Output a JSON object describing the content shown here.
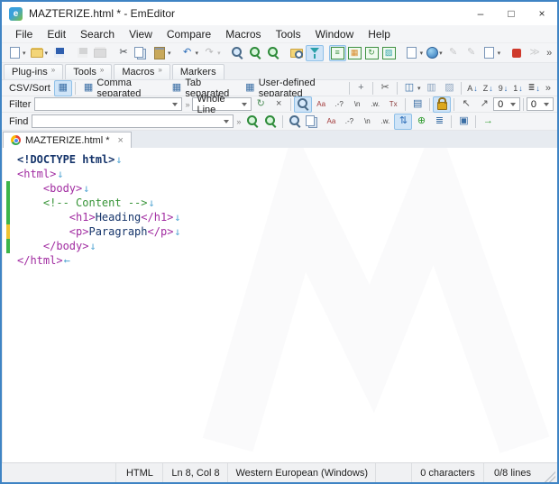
{
  "window": {
    "title": "MAZTERIZE.html * - EmEditor",
    "controls": {
      "minimize": "–",
      "maximize": "□",
      "close": "×"
    }
  },
  "menu": {
    "items": [
      "File",
      "Edit",
      "Search",
      "View",
      "Compare",
      "Macros",
      "Tools",
      "Window",
      "Help"
    ]
  },
  "toolbar_main": {
    "overflow": "»",
    "items": [
      {
        "name": "new-file",
        "shape": "page",
        "dropdown": true
      },
      {
        "name": "open-file",
        "shape": "folder",
        "dropdown": true
      },
      {
        "name": "save",
        "shape": "floppy"
      },
      {
        "sep": true
      },
      {
        "name": "save-all",
        "shape": "floppy-gray",
        "disabled": true
      },
      {
        "name": "print",
        "shape": "printer",
        "disabled": true
      },
      {
        "sep": true
      },
      {
        "name": "cut",
        "glyph": "✂",
        "color": "#3a3f44"
      },
      {
        "name": "copy",
        "shape": "copy"
      },
      {
        "name": "paste",
        "shape": "paste",
        "dropdown": true
      },
      {
        "sep": true
      },
      {
        "name": "undo",
        "glyph": "↶",
        "color": "#2b6cb8",
        "dropdown": true
      },
      {
        "name": "redo",
        "glyph": "↷",
        "color": "#555555",
        "disabled": true,
        "dropdown": true
      },
      {
        "sep": true
      },
      {
        "name": "find",
        "shape": "mag"
      },
      {
        "name": "find-next",
        "shape": "mag-green"
      },
      {
        "name": "replace",
        "shape": "mag-green"
      },
      {
        "sep": true
      },
      {
        "name": "find-in-files",
        "shape": "folder-mag"
      },
      {
        "name": "filter-toolbar-toggle",
        "shape": "funnel",
        "active": true
      },
      {
        "sep": true
      },
      {
        "name": "normal-mode",
        "shape": "gridbox",
        "glyph": "≡",
        "color": "#3f9142",
        "active": true
      },
      {
        "name": "csv-mode",
        "shape": "gridbox",
        "glyph": "▦",
        "color": "#d98b2b"
      },
      {
        "name": "wrap-mode",
        "shape": "gridbox",
        "glyph": "↻",
        "color": "#3f9142"
      },
      {
        "name": "cell-mode",
        "shape": "gridbox",
        "glyph": "▨",
        "color": "#2aa0a8"
      },
      {
        "sep": true
      },
      {
        "name": "compare",
        "shape": "page",
        "dropdown": true
      },
      {
        "name": "browser-preview",
        "shape": "globe",
        "dropdown": true
      },
      {
        "name": "edit-macro",
        "glyph": "✎",
        "color": "#777777",
        "disabled": true
      },
      {
        "name": "run-macro",
        "glyph": "✎",
        "color": "#777777",
        "disabled": true
      },
      {
        "name": "macro-list",
        "shape": "page",
        "dropdown": true
      },
      {
        "sep": true
      },
      {
        "name": "record-macro",
        "shape": "stop"
      },
      {
        "name": "play-macro",
        "glyph": "≫",
        "color": "#888888",
        "disabled": true
      }
    ]
  },
  "plugin_tabs": {
    "items": [
      {
        "label": "Plug-ins",
        "chevron": "»"
      },
      {
        "label": "Tools",
        "chevron": "»"
      },
      {
        "label": "Macros",
        "chevron": "»"
      },
      {
        "label": "Markers",
        "chevron": ""
      }
    ]
  },
  "csv_bar": {
    "label": "CSV/Sort",
    "overflow": "»",
    "modes": [
      {
        "label": "Comma separated"
      },
      {
        "label": "Tab separated"
      },
      {
        "label": "User-defined separated"
      }
    ],
    "tools": [
      {
        "name": "csv-options",
        "glyph": "+",
        "color": "#6a7078"
      },
      {
        "sep": true
      },
      {
        "name": "csv-convert",
        "glyph": "✂",
        "color": "#555555"
      },
      {
        "sep": true
      },
      {
        "name": "select-column",
        "glyph": "◫",
        "color": "#3a6ea5",
        "dropdown": true
      },
      {
        "name": "freeze-columns",
        "glyph": "▥",
        "color": "#8fa6c0"
      },
      {
        "name": "fix-columns",
        "glyph": "▨",
        "color": "#8fa6c0"
      }
    ],
    "sort_buttons": [
      {
        "name": "sort-a-to-z",
        "letter": "A",
        "arrow": "↓"
      },
      {
        "name": "sort-z-to-a",
        "letter": "Z",
        "arrow": "↓"
      },
      {
        "name": "sort-smallest-to-largest",
        "letter": "9",
        "arrow": "↓"
      },
      {
        "name": "sort-largest-to-smallest",
        "letter": "1",
        "arrow": "↓"
      },
      {
        "name": "sort-by-length",
        "letter": "≣",
        "arrow": "↓"
      }
    ]
  },
  "filter_bar": {
    "label": "Filter",
    "value": "",
    "mode_value": "Whole Line",
    "mini_chevron": "»",
    "count1": "0",
    "count2": "0",
    "icons": [
      {
        "name": "refresh-filter",
        "glyph": "↻",
        "color": "#4f8f5a"
      },
      {
        "name": "clear-filter",
        "glyph": "×",
        "color": "#555555"
      },
      {
        "sep": true
      },
      {
        "name": "filter-find",
        "shape": "mag",
        "active": true
      },
      {
        "name": "match-case-filter",
        "glyph": "Aa",
        "color": "#a33a3a",
        "tiny": true
      },
      {
        "name": "wildcard-filter",
        "glyph": ".-?",
        "tiny": true
      },
      {
        "name": "escape-sequence-filter",
        "glyph": "\\n",
        "tiny": true
      },
      {
        "name": "whole-word-filter",
        "glyph": ".w.",
        "tiny": true
      },
      {
        "name": "no-filter",
        "glyph": "Tx",
        "color": "#8a3a3a",
        "tiny": true
      },
      {
        "sep": true
      },
      {
        "name": "filter-properties",
        "glyph": "▤",
        "color": "#3a6ea5"
      },
      {
        "sep": true
      },
      {
        "name": "lock-filter",
        "shape": "lock",
        "active": true
      },
      {
        "sep": true
      },
      {
        "name": "select-matched-lines",
        "glyph": "↖",
        "color": "#555555"
      },
      {
        "name": "extract-matched-lines",
        "glyph": "↗",
        "color": "#555555"
      }
    ]
  },
  "find_bar": {
    "label": "Find",
    "value": "",
    "mini_chevron": "»",
    "icons": [
      {
        "name": "find-previous",
        "shape": "mag-green"
      },
      {
        "name": "find-next-green",
        "shape": "mag-green"
      },
      {
        "sep": true
      },
      {
        "name": "find-dialog",
        "shape": "mag"
      },
      {
        "name": "find-in-document",
        "shape": "copy"
      },
      {
        "name": "match-case-find",
        "glyph": "Aa",
        "color": "#a33a3a",
        "tiny": true
      },
      {
        "name": "wildcard-find",
        "glyph": ".-?",
        "tiny": true
      },
      {
        "name": "escape-sequence-find",
        "glyph": "\\n",
        "tiny": true
      },
      {
        "name": "whole-word-find",
        "glyph": ".w.",
        "tiny": true
      },
      {
        "name": "search-up-down",
        "glyph": "⇅",
        "color": "#2b6cb8",
        "active": true
      },
      {
        "name": "add-next-occurrence",
        "glyph": "⊕",
        "color": "#2e9b2e"
      },
      {
        "name": "find-history-list",
        "glyph": "≣",
        "color": "#3a6ea5"
      },
      {
        "sep": true
      },
      {
        "name": "find-results-panel",
        "glyph": "▣",
        "color": "#3a6ea5"
      },
      {
        "sep": true
      },
      {
        "name": "go-to",
        "glyph": "→",
        "color": "#2e9b2e"
      }
    ]
  },
  "doc_tab": {
    "title": "MAZTERIZE.html *",
    "close": "×"
  },
  "editor": {
    "lines": [
      {
        "bar": "",
        "eol": "↓",
        "tokens": [
          {
            "t": "<!DOCTYPE html>",
            "c": "doctype"
          }
        ]
      },
      {
        "bar": "",
        "eol": "↓",
        "tokens": [
          {
            "t": "<html>",
            "c": "tag"
          }
        ]
      },
      {
        "bar": "green",
        "eol": "↓",
        "tokens": [
          {
            "t": "    ",
            "c": "plain"
          },
          {
            "t": "<body>",
            "c": "tag"
          }
        ]
      },
      {
        "bar": "green",
        "eol": "↓",
        "tokens": [
          {
            "t": "    ",
            "c": "plain"
          },
          {
            "t": "<!-- Content -->",
            "c": "comment"
          }
        ]
      },
      {
        "bar": "green",
        "eol": "↓",
        "tokens": [
          {
            "t": "        ",
            "c": "plain"
          },
          {
            "t": "<h1>",
            "c": "tag"
          },
          {
            "t": "Heading",
            "c": "text"
          },
          {
            "t": "</h1>",
            "c": "tag"
          }
        ]
      },
      {
        "bar": "yellow",
        "eol": "↓",
        "tokens": [
          {
            "t": "        ",
            "c": "plain"
          },
          {
            "t": "<p>",
            "c": "tag"
          },
          {
            "t": "Paragraph",
            "c": "text"
          },
          {
            "t": "</p>",
            "c": "tag"
          }
        ]
      },
      {
        "bar": "green",
        "eol": "↓",
        "tokens": [
          {
            "t": "    ",
            "c": "plain"
          },
          {
            "t": "</body>",
            "c": "tag"
          }
        ]
      },
      {
        "bar": "",
        "eol": "←",
        "tokens": [
          {
            "t": "</html>",
            "c": "tag"
          }
        ]
      }
    ]
  },
  "status_bar": {
    "syntax": "HTML",
    "position": "Ln 8, Col 8",
    "encoding": "Western European (Windows)",
    "characters": "0 characters",
    "lines": "0/8 lines"
  },
  "colors": {
    "accent_blue": "#3f84c4",
    "change_green": "#3db54a",
    "change_yellow": "#efc431",
    "tag_purple": "#a12ca1",
    "comment_green": "#379437"
  }
}
